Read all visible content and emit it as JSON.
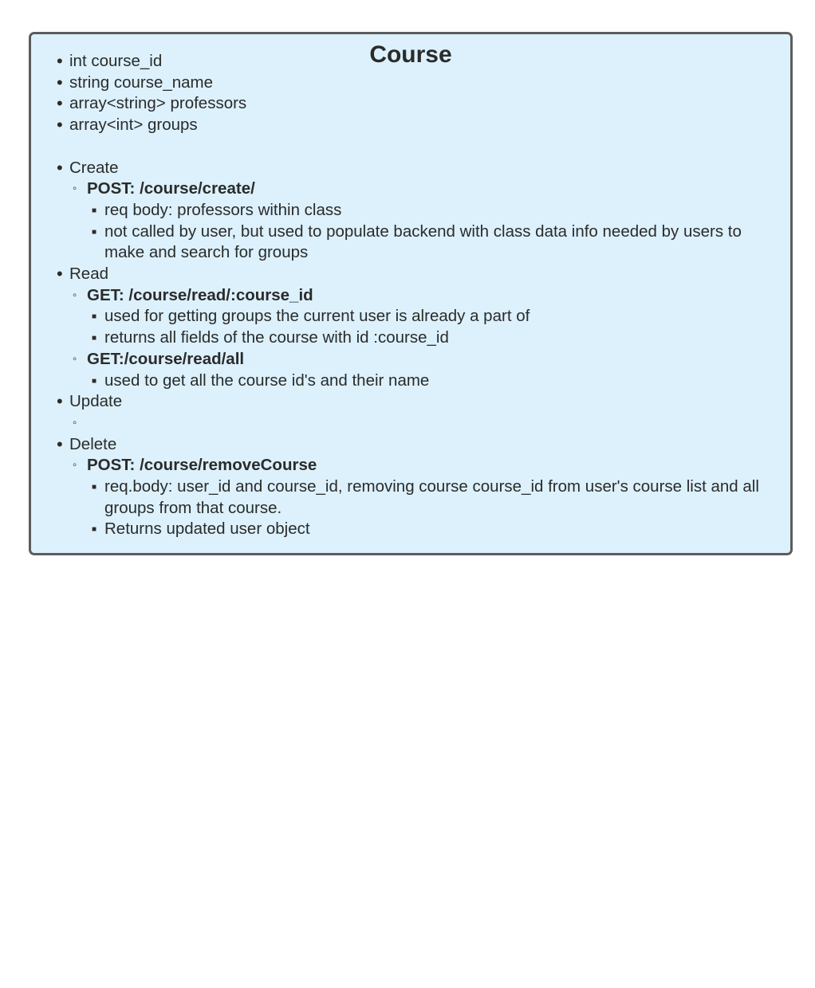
{
  "title": "Course",
  "fields": [
    "int course_id",
    "string course_name",
    "array<string> professors",
    "array<int> groups"
  ],
  "create": {
    "label": "Create",
    "endpoint": "POST: /course/create/",
    "notes": [
      "req body: professors within class",
      "not called by user, but used to populate backend with class data info needed by users to make and search for groups"
    ]
  },
  "read": {
    "label": "Read",
    "endpoints": [
      {
        "endpoint": "GET: /course/read/:course_id",
        "notes": [
          "used for getting groups the current user is already a part of",
          "returns all fields of the course with id :course_id"
        ]
      },
      {
        "endpoint": "GET:/course/read/all",
        "notes": [
          "used to get all the course id's and their name"
        ]
      }
    ]
  },
  "update": {
    "label": "Update",
    "endpoint": ""
  },
  "delete": {
    "label": "Delete",
    "endpoint": "POST: /course/removeCourse",
    "notes": [
      "req.body: user_id and course_id, removing course course_id from user's course list and all groups from that course.",
      "Returns updated user object"
    ]
  },
  "colors": {
    "box_fill": "#dcf1fc",
    "box_border": "#5c5c5c",
    "text": "#2b2b2b"
  }
}
